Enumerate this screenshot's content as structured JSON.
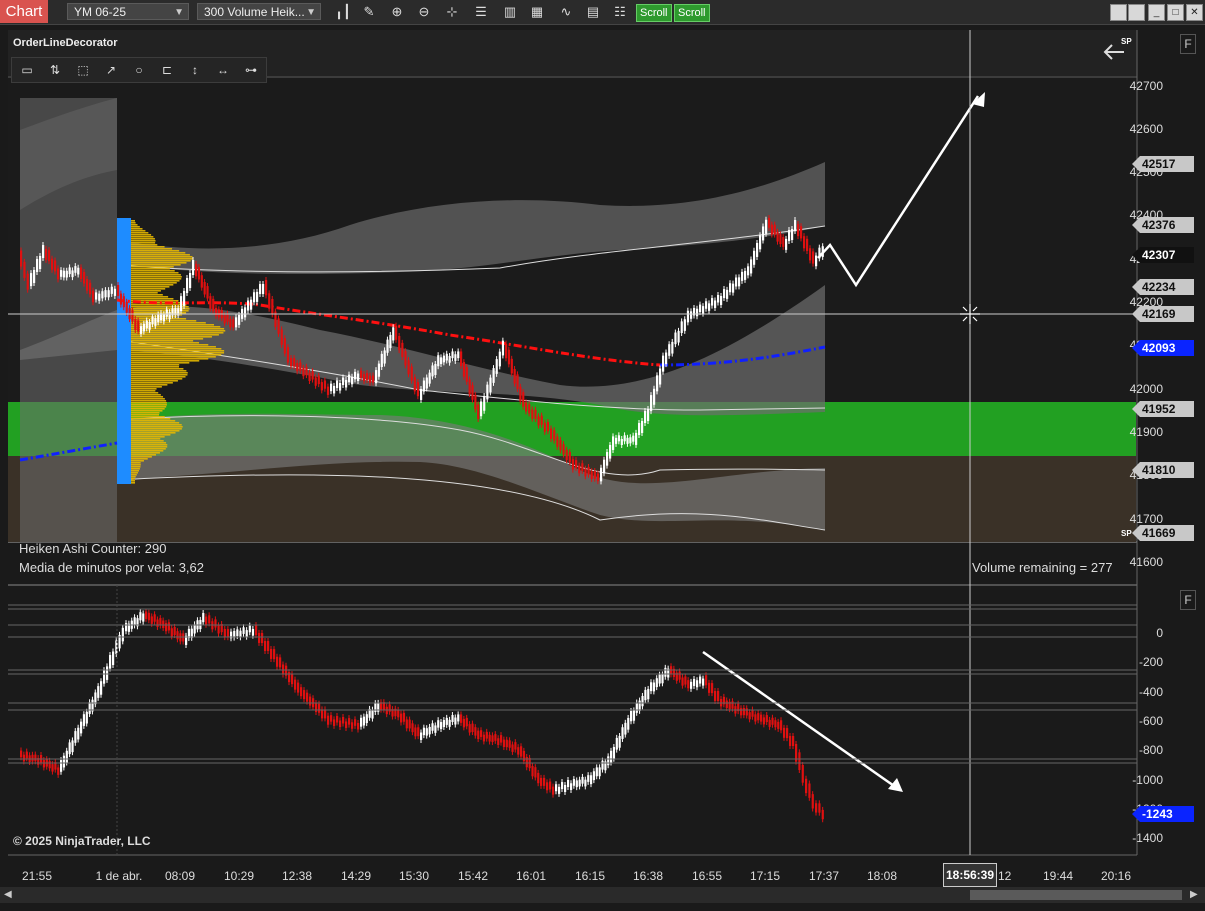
{
  "window": {
    "tab_label": "Chart",
    "instrument": "YM 06-25",
    "bar_type": "300 Volume Heik...",
    "scroll_label_1": "Scroll",
    "scroll_label_2": "Scroll",
    "toolbar_icons": [
      "bar-type-icon",
      "draw-tool-icon",
      "zoom-in-icon",
      "zoom-out-icon",
      "crosshair-icon",
      "properties-icon",
      "template-icon",
      "strategy-icon",
      "indicator-icon",
      "data-box-icon",
      "share-icon"
    ]
  },
  "main_panel": {
    "indicator_name": "OrderLineDecorator",
    "panel_flag": "F",
    "sp_label": "SP",
    "drawing_tools": [
      "ruler-icon",
      "risk-reward-icon",
      "region-icon",
      "line-icon",
      "ellipse-icon",
      "price-marker-icon",
      "vertical-line-icon",
      "horizontal-ray-icon",
      "extended-line-icon"
    ],
    "info": {
      "counter": "Heiken Ashi Counter: 290",
      "avg_minutes": "Media de minutos por vela: 3,62",
      "volume_remaining": "Volume remaining = 277"
    },
    "price_axis": [
      "42700",
      "42600",
      "42500",
      "42400",
      "42300",
      "42200",
      "42100",
      "42000",
      "41900",
      "41800",
      "41700",
      "41600"
    ],
    "price_tags": [
      {
        "value": "42517",
        "bg": "#c8c8c8",
        "fg": "#111"
      },
      {
        "value": "42376",
        "bg": "#c8c8c8",
        "fg": "#111"
      },
      {
        "value": "42307",
        "bg": "#111111",
        "fg": "#ffffff"
      },
      {
        "value": "42234",
        "bg": "#c8c8c8",
        "fg": "#111"
      },
      {
        "value": "42169",
        "bg": "#c8c8c8",
        "fg": "#111"
      },
      {
        "value": "42093",
        "bg": "#0a24ff",
        "fg": "#ffffff"
      },
      {
        "value": "41952",
        "bg": "#c8c8c8",
        "fg": "#111"
      },
      {
        "value": "41810",
        "bg": "#c8c8c8",
        "fg": "#111"
      },
      {
        "value": "41669",
        "bg": "#c8c8c8",
        "fg": "#111"
      }
    ],
    "colors": {
      "zone_green": "#22a022",
      "zone_brown": "#3a3127",
      "vwap_red": "#ff1010",
      "vwap_blue": "#1020ff",
      "profile_blue": "#1e8cff",
      "profile_gold": "#e6b800"
    }
  },
  "lower_panel": {
    "panel_flag": "F",
    "axis": [
      "0",
      "-200",
      "-400",
      "-600",
      "-800",
      "-1000",
      "-1200",
      "-1400"
    ],
    "current_tag": {
      "value": "-1243",
      "bg": "#0a24ff",
      "fg": "#ffffff"
    }
  },
  "time_axis": [
    "21:55",
    "1 de abr.",
    "08:09",
    "10:29",
    "12:38",
    "14:29",
    "15:30",
    "15:42",
    "16:01",
    "16:15",
    "16:38",
    "16:55",
    "17:15",
    "17:37",
    "18:08",
    "18:56:39",
    ":12",
    "19:44",
    "20:16"
  ],
  "cursor_time": "18:56:39",
  "copyright": "© 2025 NinjaTrader, LLC"
}
